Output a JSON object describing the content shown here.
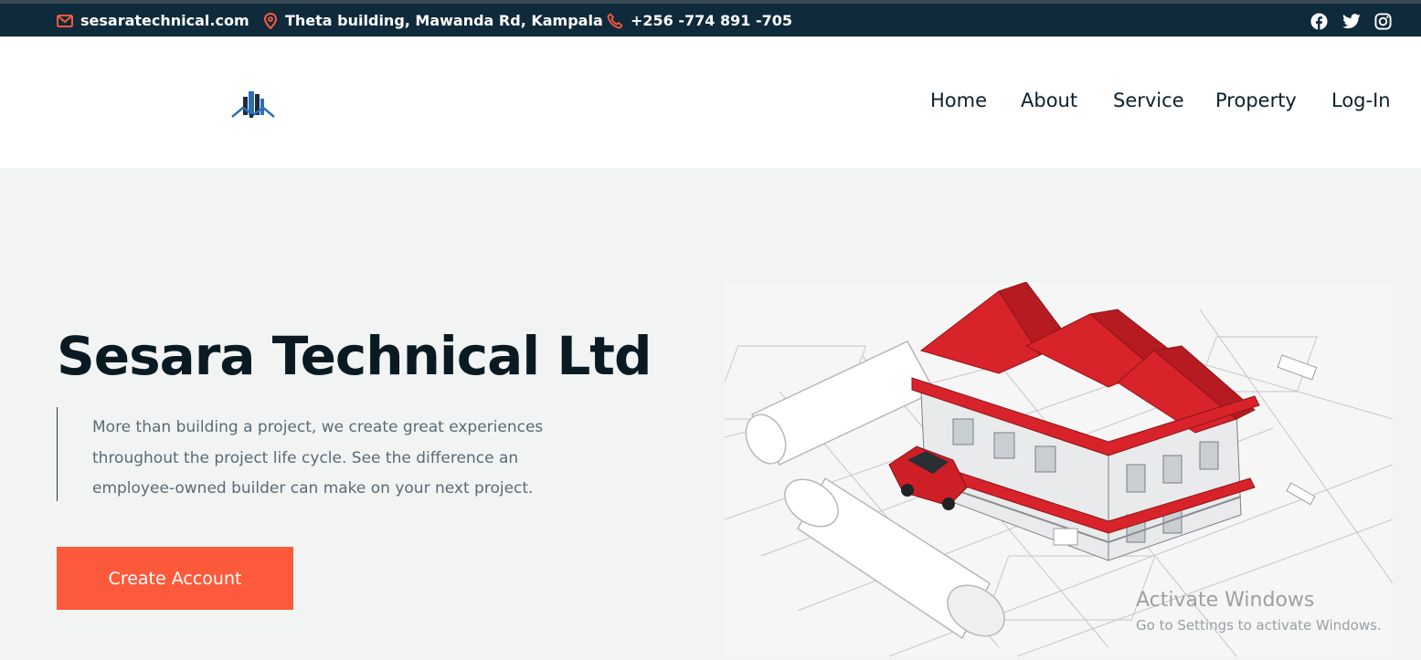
{
  "topbar": {
    "email": "sesaratechnical.com",
    "address": "Theta building, Mawanda Rd, Kampala",
    "phone": "+256 -774 891 -705",
    "social": [
      "facebook-icon",
      "twitter-icon",
      "instagram-icon"
    ]
  },
  "nav": {
    "items": [
      "Home",
      "About",
      "Service",
      "Property",
      "Log-In"
    ]
  },
  "hero": {
    "title": "Sesara Technical Ltd",
    "description_lines": [
      "More than building a project, we create great experiences",
      "throughout the project life cycle. See the difference an",
      "employee-owned builder can make on your next project."
    ],
    "cta_label": "Create Account"
  },
  "system_overlay": {
    "line1": "Activate Windows",
    "line2": "Go to Settings to activate Windows."
  },
  "colors": {
    "topbar_bg": "#0e2a3b",
    "accent": "#fd5a3b",
    "hero_bg": "#f2f4f4",
    "roof_red": "#d8232a"
  }
}
